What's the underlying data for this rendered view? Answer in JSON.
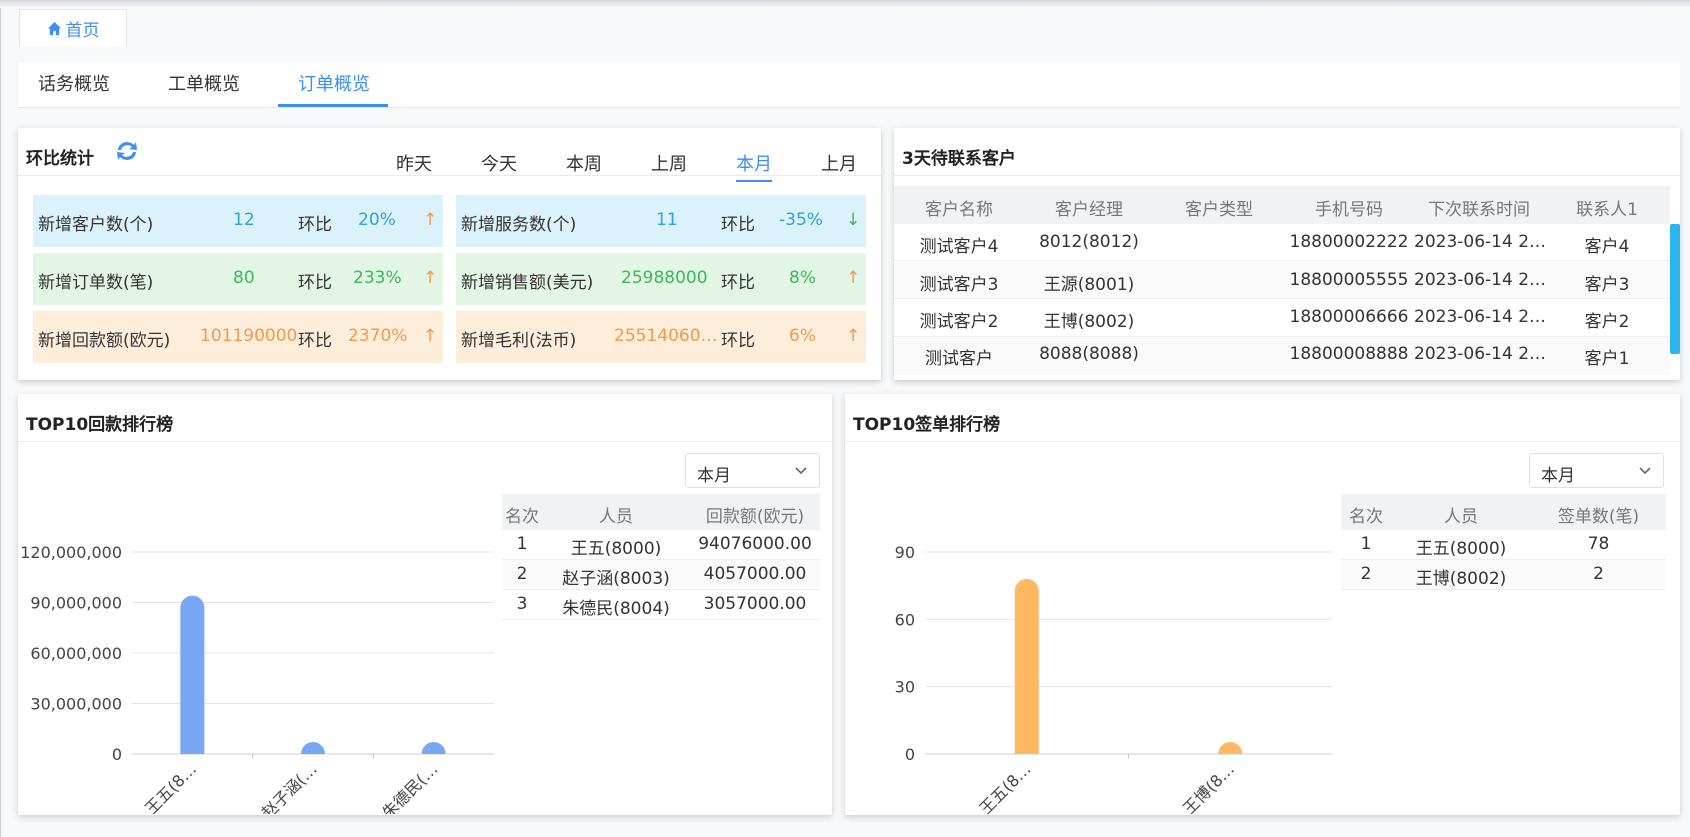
{
  "breadcrumb": {
    "home_label": "首页"
  },
  "tabs": [
    {
      "label": "话务概览",
      "active": false
    },
    {
      "label": "工单概览",
      "active": false
    },
    {
      "label": "订单概览",
      "active": true
    }
  ],
  "compare": {
    "title": "环比统计",
    "periods": [
      {
        "label": "昨天",
        "active": false
      },
      {
        "label": "今天",
        "active": false
      },
      {
        "label": "本周",
        "active": false
      },
      {
        "label": "上周",
        "active": false
      },
      {
        "label": "本月",
        "active": true
      },
      {
        "label": "上月",
        "active": false
      }
    ],
    "ratio_label": "环比",
    "stats": [
      {
        "label": "新增客户数(个)",
        "value": "12",
        "ratio": "20%",
        "trend": "↑",
        "color": "blue"
      },
      {
        "label": "新增服务数(个)",
        "value": "11",
        "ratio": "-35%",
        "trend": "↓",
        "color": "blue"
      },
      {
        "label": "新增订单数(笔)",
        "value": "80",
        "ratio": "233%",
        "trend": "↑",
        "color": "green"
      },
      {
        "label": "新增销售额(美元)",
        "value": "25988000",
        "ratio": "8%",
        "trend": "↑",
        "color": "green"
      },
      {
        "label": "新增回款额(欧元)",
        "value": "101190000",
        "ratio": "2370%",
        "trend": "↑",
        "color": "orange"
      },
      {
        "label": "新增毛利(法币)",
        "value": "25514060…",
        "ratio": "6%",
        "trend": "↑",
        "color": "orange"
      }
    ]
  },
  "contacts": {
    "title": "3天待联系客户",
    "columns": [
      "客户名称",
      "客户经理",
      "客户类型",
      "手机号码",
      "下次联系时间",
      "联系人1"
    ],
    "rows": [
      [
        "测试客户4",
        "8012(8012)",
        "",
        "18800002222",
        "2023-06-14 2…",
        "客户4"
      ],
      [
        "测试客户3",
        "王源(8001)",
        "",
        "18800005555",
        "2023-06-14 2…",
        "客户3"
      ],
      [
        "测试客户2",
        "王博(8002)",
        "",
        "18800006666",
        "2023-06-14 2…",
        "客户2"
      ],
      [
        "测试客户",
        "8088(8088)",
        "",
        "18800008888",
        "2023-06-14 2…",
        "客户1"
      ]
    ]
  },
  "payment_rank": {
    "title": "TOP10回款排行榜",
    "period_select": "本月",
    "columns": [
      "名次",
      "人员",
      "回款额(欧元)"
    ],
    "rows": [
      [
        "1",
        "王五(8000)",
        "94076000.00"
      ],
      [
        "2",
        "赵子涵(8003)",
        "4057000.00"
      ],
      [
        "3",
        "朱德民(8004)",
        "3057000.00"
      ]
    ]
  },
  "sign_rank": {
    "title": "TOP10签单排行榜",
    "period_select": "本月",
    "columns": [
      "名次",
      "人员",
      "签单数(笔)"
    ],
    "rows": [
      [
        "1",
        "王五(8000)",
        "78"
      ],
      [
        "2",
        "王博(8002)",
        "2"
      ]
    ]
  },
  "chart_data": [
    {
      "type": "bar",
      "categories": [
        "王五(8…",
        "赵子涵(…",
        "朱德民(…"
      ],
      "values": [
        94076000,
        4057000,
        3057000
      ],
      "ylim": [
        0,
        120000000
      ],
      "yticks": [
        "0",
        "30,000,000",
        "60,000,000",
        "90,000,000",
        "120,000,000"
      ],
      "color": "#78a8f4",
      "grid": true
    },
    {
      "type": "bar",
      "categories": [
        "王五(8…",
        "王博(8…"
      ],
      "values": [
        78,
        2
      ],
      "ylim": [
        0,
        90
      ],
      "yticks": [
        "0",
        "30",
        "60",
        "90"
      ],
      "color": "#ffb862",
      "grid": true
    }
  ],
  "colors": {
    "accent": "#3e8ef7",
    "blue_tile": "#dbf1fb",
    "green_tile": "#e3f6e6",
    "orange_tile": "#fdeedb"
  }
}
